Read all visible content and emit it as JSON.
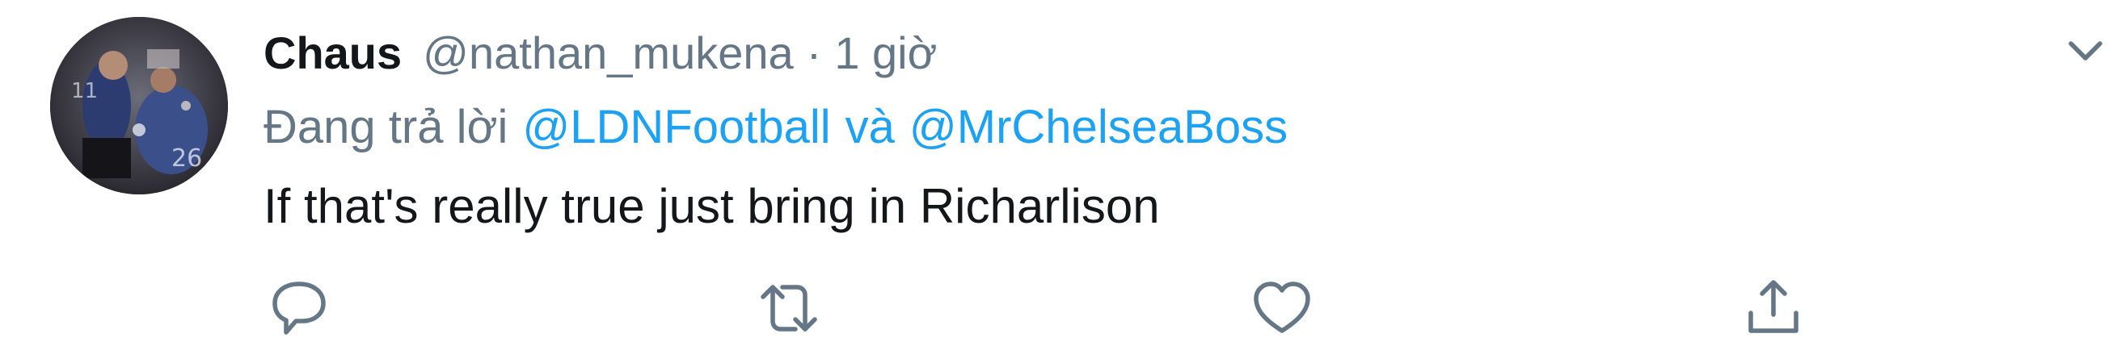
{
  "tweet": {
    "author_name": "Chaus",
    "author_handle": "@nathan_mukena",
    "separator": "·",
    "time": "1 giờ",
    "reply_prefix": "Đang trả lời",
    "mention_1": "@LDNFootball",
    "conjunction": "và",
    "mention_2": "@MrChelseaBoss",
    "text": "If that's really true just bring in Richarlison"
  },
  "icons": {
    "more": "chevron-down-icon",
    "reply": "reply-icon",
    "retweet": "retweet-icon",
    "like": "heart-icon",
    "share": "share-icon"
  },
  "colors": {
    "link": "#1da1f2",
    "secondary_text": "#657786",
    "primary_text": "#14171a"
  }
}
